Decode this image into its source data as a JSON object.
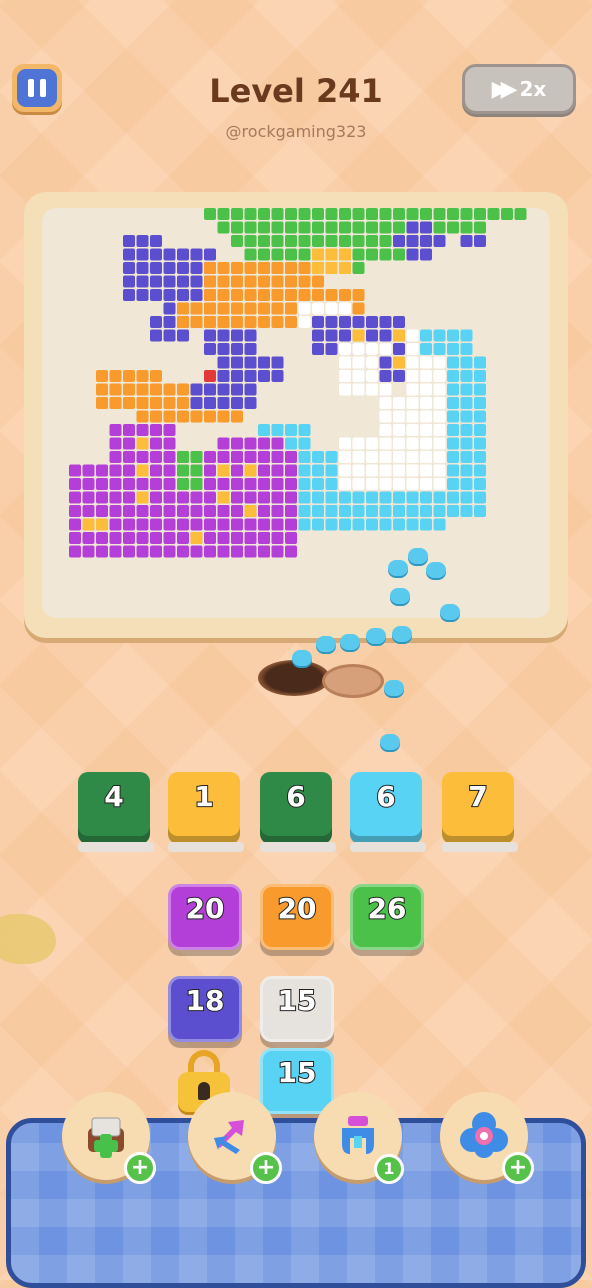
{
  "header": {
    "title": "Level 241",
    "username": "@rockgaming323",
    "speed_label": "2x"
  },
  "icons": [
    "pause-icon",
    "fast-forward-icon",
    "ant-icon",
    "padlock-icon",
    "add-slot-icon",
    "swap-arrows-icon",
    "magnet-claw-icon",
    "flower-button-icon"
  ],
  "colors": {
    "green": "#4cc14a",
    "dark_green": "#2f8a48",
    "orange": "#f89a2c",
    "yellow": "#fbbd3a",
    "blue": "#5b4fd0",
    "purple": "#b33fd8",
    "light_blue": "#59d3f3",
    "white": "#ffffff",
    "red": "#e23a3a",
    "grey": "#e6e2de"
  },
  "slots": [
    {
      "count": "4",
      "color": "dark_green"
    },
    {
      "count": "1",
      "color": "yellow"
    },
    {
      "count": "6",
      "color": "dark_green"
    },
    {
      "count": "6",
      "color": "light_blue"
    },
    {
      "count": "7",
      "color": "yellow"
    }
  ],
  "stacks": [
    {
      "count": "20",
      "color": "purple"
    },
    {
      "count": "20",
      "color": "orange"
    },
    {
      "count": "26",
      "color": "green"
    },
    {
      "count": "18",
      "color": "blue"
    },
    {
      "count": "15",
      "color": "grey"
    },
    {
      "count": "15",
      "color": "light_blue"
    }
  ],
  "boosters": [
    {
      "name": "add-slot",
      "badge": "+"
    },
    {
      "name": "swap",
      "badge": "+"
    },
    {
      "name": "magnet",
      "badge": "1"
    },
    {
      "name": "flower",
      "badge": "+"
    }
  ]
}
